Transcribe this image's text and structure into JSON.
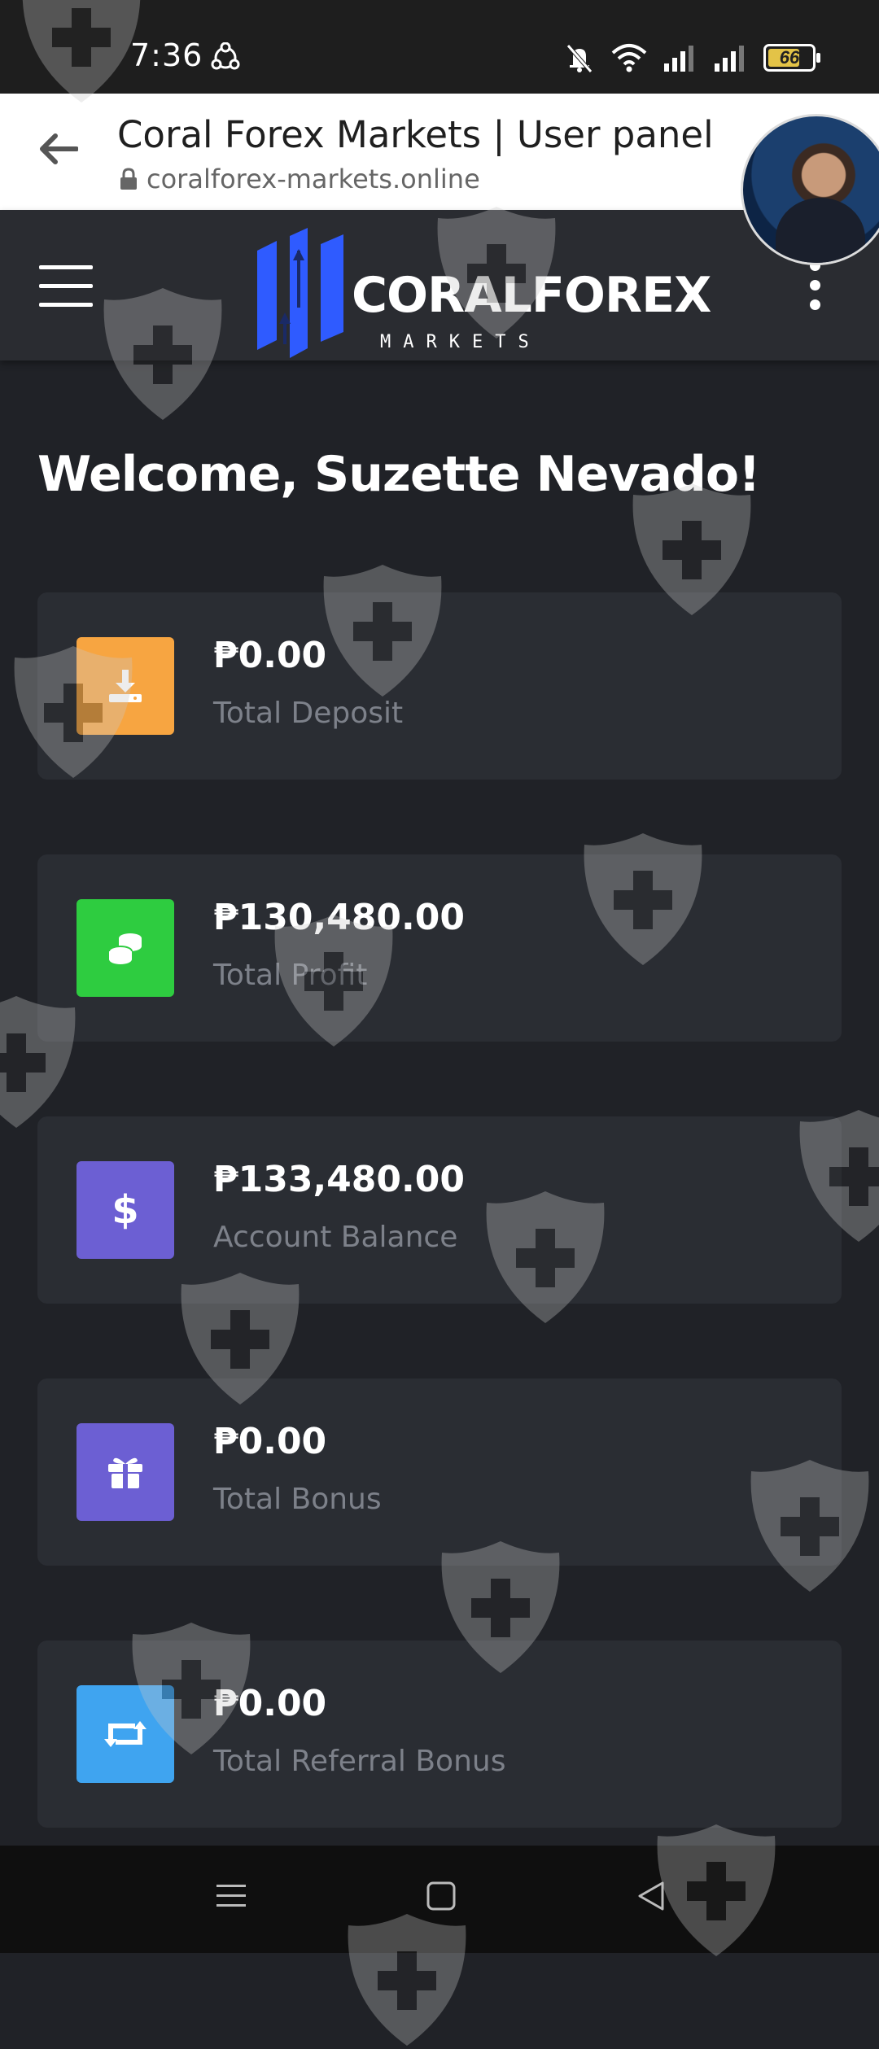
{
  "status_bar": {
    "time": "7:36",
    "battery": "66"
  },
  "browser": {
    "title": "Coral Forex Markets | User panel",
    "url": "coralforex-markets.online"
  },
  "app": {
    "brand": "CORALFOREX",
    "brand_sub": "MARKETS",
    "welcome": "Welcome, Suzette Nevado!"
  },
  "cards": [
    {
      "amount": "₱0.00",
      "label": "Total Deposit",
      "icon": "download-icon",
      "color": "#f7a541"
    },
    {
      "amount": "₱130,480.00",
      "label": "Total Profit",
      "icon": "coins-icon",
      "color": "#2ecc40"
    },
    {
      "amount": "₱133,480.00",
      "label": "Account Balance",
      "icon": "dollar-icon",
      "color": "#6c5fd3"
    },
    {
      "amount": "₱0.00",
      "label": "Total Bonus",
      "icon": "gift-icon",
      "color": "#6c5fd3"
    },
    {
      "amount": "₱0.00",
      "label": "Total Referral Bonus",
      "icon": "retweet-icon",
      "color": "#3fa4f0"
    }
  ],
  "colors": {
    "background": "#202227",
    "header": "#2a2c31",
    "card": "#2a2d33",
    "logo_blue": "#2f5bff"
  }
}
